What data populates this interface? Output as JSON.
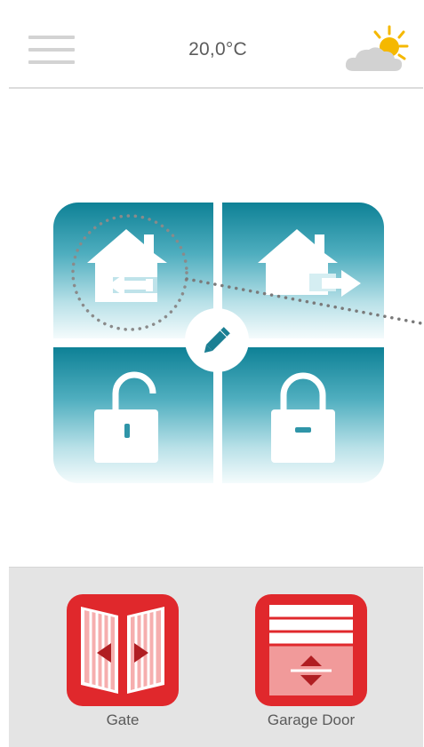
{
  "header": {
    "menu_icon": "hamburger-menu-icon",
    "temperature": "20,0°C",
    "weather_icon": "partly-sunny-icon"
  },
  "panel": {
    "buttons": [
      {
        "icon": "house-arrive-icon",
        "highlighted": true
      },
      {
        "icon": "house-leave-icon",
        "highlighted": false
      },
      {
        "icon": "unlock-icon",
        "highlighted": false
      },
      {
        "icon": "lock-icon",
        "highlighted": false
      }
    ],
    "edit_icon": "pencil-icon"
  },
  "devices": [
    {
      "label": "Gate",
      "icon": "gate-icon"
    },
    {
      "label": "Garage Door",
      "icon": "garage-door-icon"
    }
  ],
  "colors": {
    "teal_dark": "#0e8196",
    "device_red": "#e0282c",
    "bar_gray": "#e4e4e4",
    "sun_yellow": "#f5b800"
  }
}
